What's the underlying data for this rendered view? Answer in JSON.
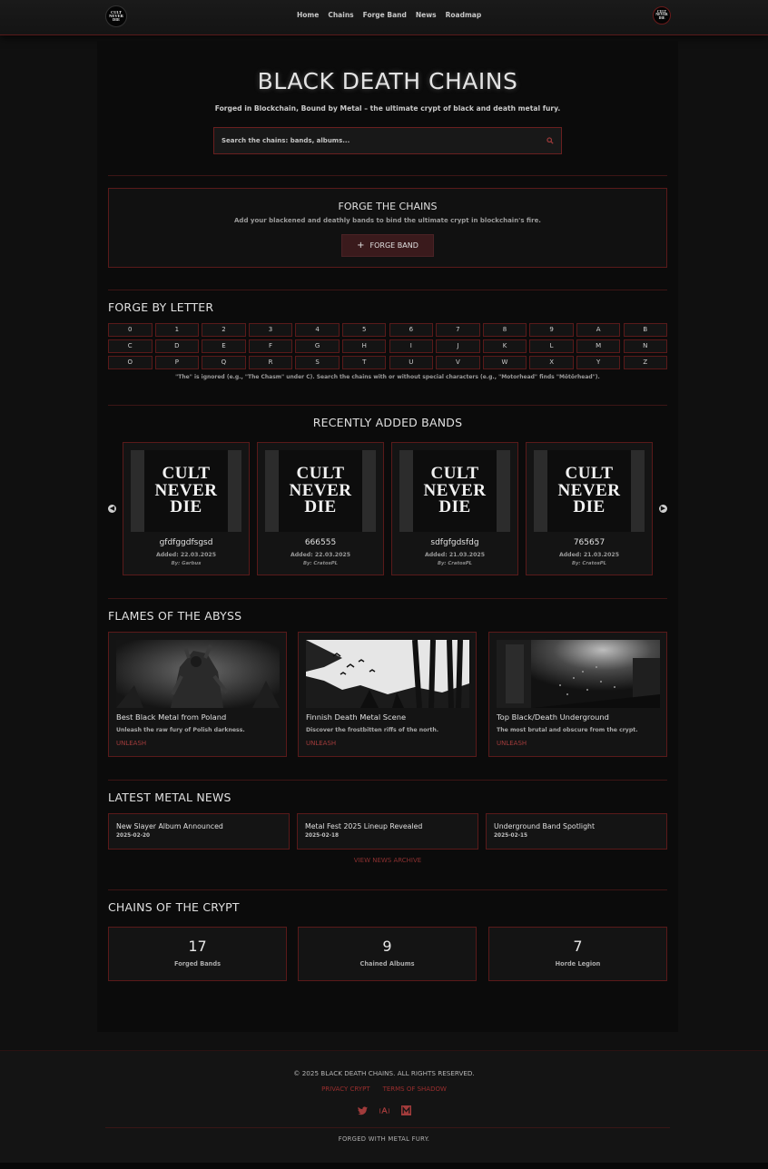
{
  "nav": {
    "logo_text": [
      "CULT",
      "NEVER",
      "DIE"
    ],
    "links": [
      "Home",
      "Chains",
      "Forge Band",
      "News",
      "Roadmap"
    ]
  },
  "hero": {
    "title": "BLACK DEATH CHAINS",
    "subtitle": "Forged in Blockchain, Bound by Metal – the ultimate crypt of black and death metal fury.",
    "search_placeholder": "Search the chains: bands, albums..."
  },
  "forge": {
    "title": "FORGE THE CHAINS",
    "subtitle": "Add your blackened and deathly bands to bind the ultimate crypt in blockchain's fire.",
    "button_label": "FORGE BAND"
  },
  "letters": {
    "title": "FORGE BY LETTER",
    "items": [
      "0",
      "1",
      "2",
      "3",
      "4",
      "5",
      "6",
      "7",
      "8",
      "9",
      "A",
      "B",
      "C",
      "D",
      "E",
      "F",
      "G",
      "H",
      "I",
      "J",
      "K",
      "L",
      "M",
      "N",
      "O",
      "P",
      "Q",
      "R",
      "S",
      "T",
      "U",
      "V",
      "W",
      "X",
      "Y",
      "Z"
    ],
    "note": "\"The\" is ignored (e.g., \"The Chasm\" under C). Search the chains with or without special characters (e.g., \"Motorhead\" finds \"Mötörhead\")."
  },
  "recent": {
    "title": "RECENTLY ADDED BANDS",
    "cover_text": [
      "CULT",
      "NEVER",
      "DIE"
    ],
    "bands": [
      {
        "name": "gfdfggdfsgsd",
        "added": "Added: 22.03.2025",
        "by": "By: Garbus"
      },
      {
        "name": "666555",
        "added": "Added: 22.03.2025",
        "by": "By: CratosPL"
      },
      {
        "name": "sdfgfgdsfdg",
        "added": "Added: 21.03.2025",
        "by": "By: CratosPL"
      },
      {
        "name": "765657",
        "added": "Added: 21.03.2025",
        "by": "By: CratosPL"
      }
    ]
  },
  "flames": {
    "title": "FLAMES OF THE ABYSS",
    "link_label": "UNLEASH",
    "items": [
      {
        "title": "Best Black Metal from Poland",
        "desc": "Unleash the raw fury of Polish darkness."
      },
      {
        "title": "Finnish Death Metal Scene",
        "desc": "Discover the frostbitten riffs of the north."
      },
      {
        "title": "Top Black/Death Underground",
        "desc": "The most brutal and obscure from the crypt."
      }
    ]
  },
  "news": {
    "title": "LATEST METAL NEWS",
    "items": [
      {
        "title": "New Slayer Album Announced",
        "date": "2025-02-20"
      },
      {
        "title": "Metal Fest 2025 Lineup Revealed",
        "date": "2025-02-18"
      },
      {
        "title": "Underground Band Spotlight",
        "date": "2025-02-15"
      }
    ],
    "archive_label": "VIEW NEWS ARCHIVE"
  },
  "stats": {
    "title": "CHAINS OF THE CRYPT",
    "items": [
      {
        "value": "17",
        "label": "Forged Bands"
      },
      {
        "value": "9",
        "label": "Chained Albums"
      },
      {
        "value": "7",
        "label": "Horde Legion"
      }
    ]
  },
  "footer": {
    "copyright": "© 2025 BLACK DEATH CHAINS. ALL RIGHTS RESERVED.",
    "links": [
      "PRIVACY CRYPT",
      "TERMS OF SHADOW"
    ],
    "icons": [
      "twitter-icon",
      "music-store-icon",
      "m-logo-icon"
    ],
    "forged": "FORGED WITH METAL FURY."
  },
  "colors": {
    "accent": "#a13b3b",
    "border": "#5a1a1a",
    "background": "#0b0b0b"
  }
}
